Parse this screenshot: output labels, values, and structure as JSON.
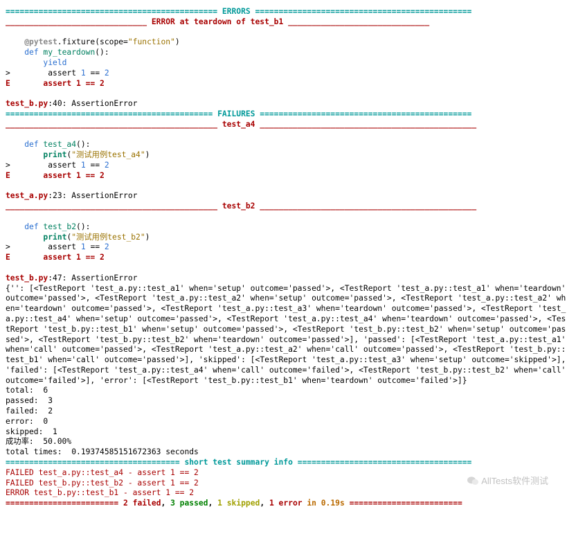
{
  "headers": {
    "errors": " ERRORS ",
    "error_teardown": " ERROR at teardown of test_b1 ",
    "failures": " FAILURES ",
    "test_a4": " test_a4 ",
    "test_b2": " test_b2 ",
    "summary_info": " short test summary info ",
    "final_line": " 2 failed, 3 passed, 1 skipped, 1 error in 0.19s "
  },
  "decorator": {
    "name": "    @pytest",
    "rest": ".fixture(scope=",
    "arg": "\"function\"",
    "close": ")"
  },
  "fn1": {
    "def": "    def",
    "name": " my_teardown",
    "sig": "():",
    "yield": "        yield",
    "assert_line": "        assert ",
    "one": "1",
    "eq": " == ",
    "two": "2",
    "e_line": "E       assert 1 == 2",
    "loc": "test_b.py",
    "loc_rest": ":40: AssertionError"
  },
  "fn2": {
    "def": "    def",
    "name": " test_a4",
    "sig": "():",
    "print": "        print",
    "popen": "(",
    "msg": "\"测试用例test_a4\"",
    "pclose": ")",
    "assert_line": "        assert ",
    "one": "1",
    "eq": " == ",
    "two": "2",
    "e_line": "E       assert 1 == 2",
    "loc": "test_a.py",
    "loc_rest": ":23: AssertionError"
  },
  "fn3": {
    "def": "    def",
    "name": " test_b2",
    "sig": "():",
    "print": "        print",
    "popen": "(",
    "msg": "\"测试用例test_b2\"",
    "pclose": ")",
    "assert_line": "        assert ",
    "one": "1",
    "eq": " == ",
    "two": "2",
    "e_line": "E       assert 1 == 2",
    "loc": "test_b.py",
    "loc_rest": ":47: AssertionError"
  },
  "dict_dump": "{'': [<TestReport 'test_a.py::test_a1' when='setup' outcome='passed'>, <TestReport 'test_a.py::test_a1' when='teardown' outcome='passed'>, <TestReport 'test_a.py::test_a2' when='setup' outcome='passed'>, <TestReport 'test_a.py::test_a2' when='teardown' outcome='passed'>, <TestReport 'test_a.py::test_a3' when='teardown' outcome='passed'>, <TestReport 'test_a.py::test_a4' when='setup' outcome='passed'>, <TestReport 'test_a.py::test_a4' when='teardown' outcome='passed'>, <TestReport 'test_b.py::test_b1' when='setup' outcome='passed'>, <TestReport 'test_b.py::test_b2' when='setup' outcome='passed'>, <TestReport 'test_b.py::test_b2' when='teardown' outcome='passed'>], 'passed': [<TestReport 'test_a.py::test_a1' when='call' outcome='passed'>, <TestReport 'test_a.py::test_a2' when='call' outcome='passed'>, <TestReport 'test_b.py::test_b1' when='call' outcome='passed'>], 'skipped': [<TestReport 'test_a.py::test_a3' when='setup' outcome='skipped'>], 'failed': [<TestReport 'test_a.py::test_a4' when='call' outcome='failed'>, <TestReport 'test_b.py::test_b2' when='call' outcome='failed'>], 'error': [<TestReport 'test_b.py::test_b1' when='teardown' outcome='failed'>]}",
  "stats": {
    "total": "total:  6",
    "passed": "passed:  3",
    "failed": "failed:  2",
    "error": "error:  0",
    "skipped": "skipped:  1",
    "rate": "成功率:  50.00%",
    "times": "total times:  0.19374585151672363 seconds"
  },
  "summary": {
    "l1": "FAILED test_a.py::test_a4 - assert 1 == 2",
    "l2": "FAILED test_b.py::test_b2 - assert 1 == 2",
    "l3": "ERROR test_b.py::test_b1 - assert 1 == 2"
  },
  "final": {
    "eq_l": "======================== ",
    "failed": "2 failed",
    "c1": ", ",
    "passed": "3 passed",
    "c2": ", ",
    "skipped": "1 skipped",
    "c3": ", ",
    "error": "1 error",
    "time": " in 0.19s",
    "eq_r": " ========================"
  },
  "watermark": "AllTests软件测试"
}
